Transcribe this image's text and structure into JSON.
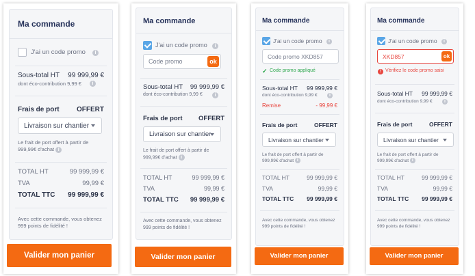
{
  "panels": [
    {
      "title": "Ma commande",
      "promo_label": "J'ai un code promo",
      "subtotal_label": "Sous-total HT",
      "subtotal_value": "99 999,99 €",
      "eco_label": "dont éco-contribution 9,99 €",
      "shipping_label": "Frais de port",
      "shipping_value": "OFFERT",
      "delivery_option": "Livraison sur chantier",
      "shipping_note": "Le frait de port offert à partir de 999,99€ d'achat",
      "total_ht_label": "TOTAL HT",
      "total_ht_value": "99 999,99 €",
      "tva_label": "TVA",
      "tva_value": "99,99 €",
      "total_ttc_label": "TOTAL TTC",
      "total_ttc_value": "99 999,99 €",
      "loyalty_note": "Avec cette commande, vous obtenez 999 points de fidélité !",
      "cta_label": "Valider mon panier"
    },
    {
      "title": "Ma commande",
      "promo_label": "J'ai un code promo",
      "promo_placeholder": "Code promo",
      "ok_label": "ok",
      "subtotal_label": "Sous-total HT",
      "subtotal_value": "99 999,99 €",
      "eco_label": "dont éco-contribution 9,99 €",
      "shipping_label": "Frais de port",
      "shipping_value": "OFFERT",
      "delivery_option": "Livraison sur chantier",
      "shipping_note": "Le frait de port offert à partir de 999,99€ d'achat",
      "total_ht_label": "TOTAL HT",
      "total_ht_value": "99 999,99 €",
      "tva_label": "TVA",
      "tva_value": "99,99 €",
      "total_ttc_label": "TOTAL TTC",
      "total_ttc_value": "99 999,99 €",
      "loyalty_note": "Avec cette commande, vous obtenez 999 points de fidélité !",
      "cta_label": "Valider mon panier"
    },
    {
      "title": "Ma commande",
      "promo_label": "J'ai un code promo",
      "promo_value": "Code promo XKD857",
      "ok_label": "ok",
      "promo_status": "Code promo appliqué",
      "subtotal_label": "Sous-total HT",
      "subtotal_value": "99 999,99 €",
      "eco_label": "dont éco-contribution 9,99 €",
      "discount_label": "Remise",
      "discount_value": "- 99,99 €",
      "shipping_label": "Frais de port",
      "shipping_value": "OFFERT",
      "delivery_option": "Livraison sur chantier",
      "shipping_note": "Le frait de port offert à partir de 999,99€ d'achat",
      "total_ht_label": "TOTAL HT",
      "total_ht_value": "99 999,99 €",
      "tva_label": "TVA",
      "tva_value": "99,99 €",
      "total_ttc_label": "TOTAL TTC",
      "total_ttc_value": "99 999,99 €",
      "loyalty_note": "Avec cette commande, vous obtenez 999 points de fidélité !",
      "cta_label": "Valider mon panier"
    },
    {
      "title": "Ma commande",
      "promo_label": "J'ai un code promo",
      "promo_value": "XKD857",
      "ok_label": "ok",
      "promo_status": "Vérifiez le code promo saisi",
      "subtotal_label": "Sous-total HT",
      "subtotal_value": "99 999,99 €",
      "eco_label": "dont éco-contribution 9,99 €",
      "shipping_label": "Frais de port",
      "shipping_value": "OFFERT",
      "delivery_option": "Livraison sur chantier",
      "shipping_note": "Le frait de port offert à partir de 999,99€ d'achat",
      "total_ht_label": "TOTAL HT",
      "total_ht_value": "99 999,99 €",
      "tva_label": "TVA",
      "tva_value": "99,99 €",
      "total_ttc_label": "TOTAL TTC",
      "total_ttc_value": "99 999,99 €",
      "loyalty_note": "Avec cette commande, vous obtenez 999 points de fidélité !",
      "cta_label": "Valider mon panier"
    }
  ],
  "colors": {
    "accent": "#f46a12",
    "checkbox": "#5aa6e6",
    "success": "#2fa84f",
    "error": "#e8463f",
    "title": "#26325a"
  },
  "icons": {
    "info": "info-icon",
    "success": "check-circle-icon",
    "error": "alert-circle-icon",
    "dropdown": "chevron-down-icon"
  }
}
